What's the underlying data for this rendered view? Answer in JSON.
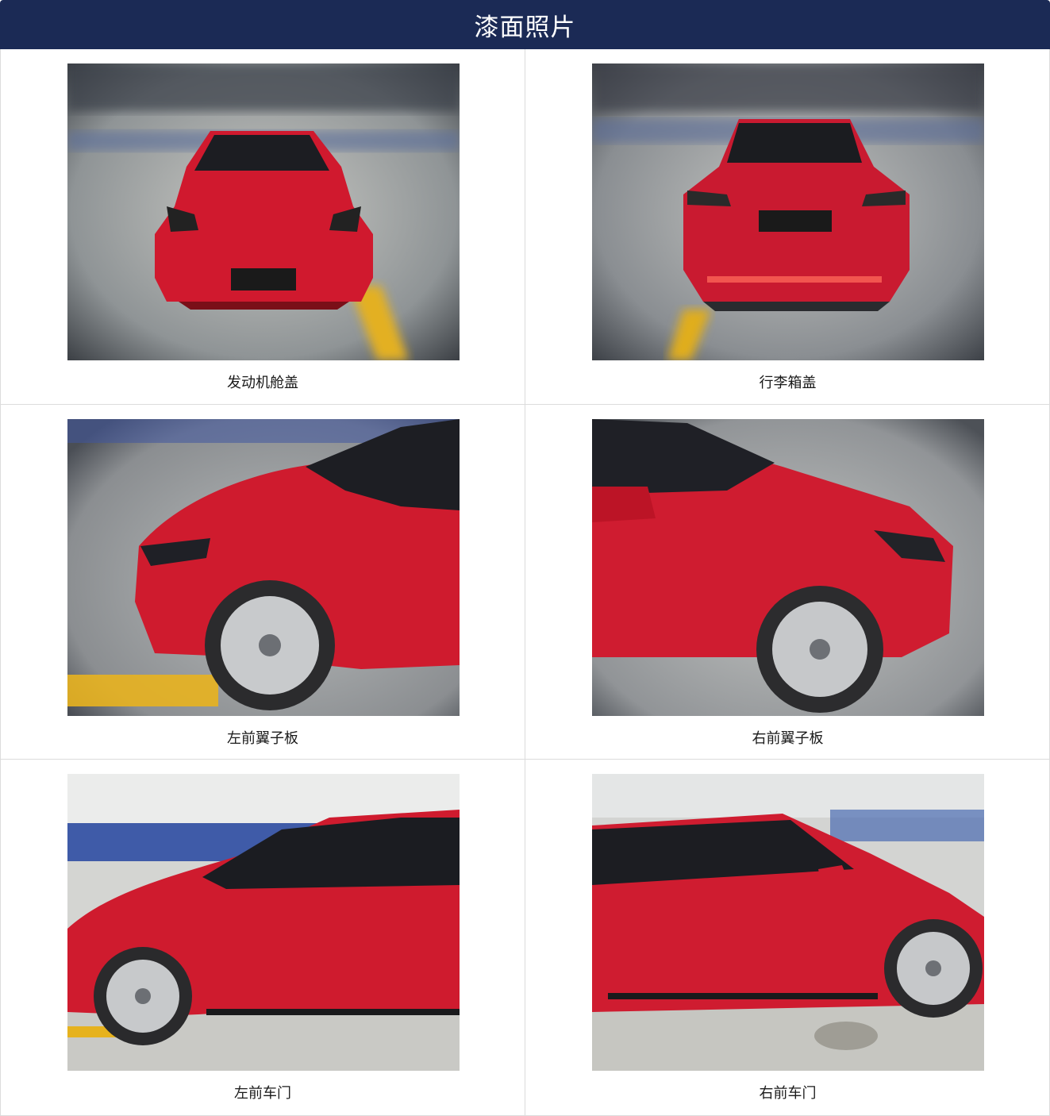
{
  "header": {
    "title": "漆面照片",
    "background_color": "#1b2a55"
  },
  "photos": [
    {
      "caption": "发动机舱盖",
      "view": "front",
      "car_color": "#d0192e"
    },
    {
      "caption": "行李箱盖",
      "view": "rear",
      "car_color": "#d0192e"
    },
    {
      "caption": "左前翼子板",
      "view": "left-front-fender",
      "car_color": "#d0192e"
    },
    {
      "caption": "右前翼子板",
      "view": "right-front-fender",
      "car_color": "#d0192e"
    },
    {
      "caption": "左前车门",
      "view": "left-side",
      "car_color": "#d0192e"
    },
    {
      "caption": "右前车门",
      "view": "right-side",
      "car_color": "#d0192e"
    }
  ]
}
